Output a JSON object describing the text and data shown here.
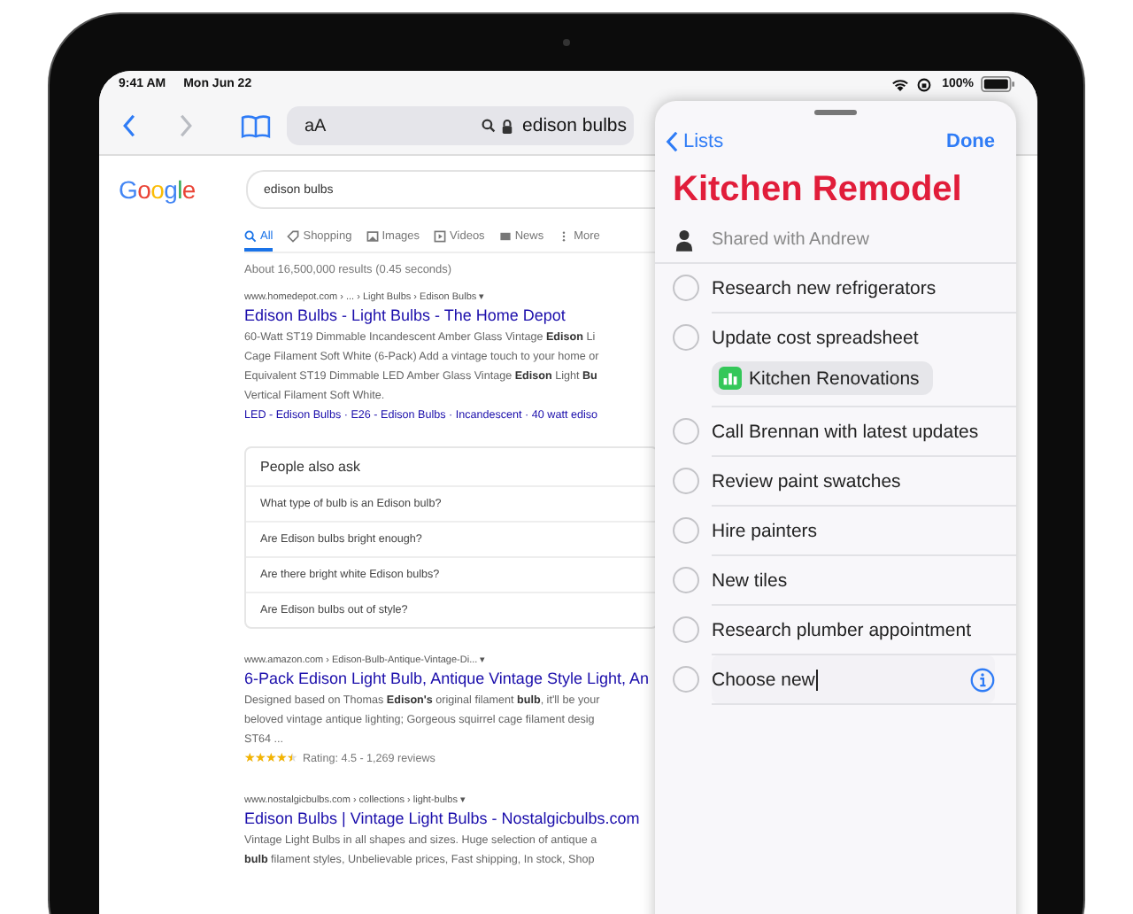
{
  "status_bar": {
    "time": "9:41 AM",
    "date": "Mon Jun 22",
    "battery": "100%"
  },
  "toolbar": {
    "text_size": "aA",
    "address": "edison bulbs"
  },
  "google": {
    "logo": "Google",
    "query": "edison bulbs",
    "tabs": [
      {
        "label": "All",
        "selected": true,
        "kind": "search"
      },
      {
        "label": "Shopping",
        "selected": false,
        "kind": "tag"
      },
      {
        "label": "Images",
        "selected": false,
        "kind": "image"
      },
      {
        "label": "Videos",
        "selected": false,
        "kind": "video"
      },
      {
        "label": "News",
        "selected": false,
        "kind": "news"
      },
      {
        "label": "More",
        "selected": false,
        "kind": "more"
      }
    ],
    "stats": "About 16,500,000 results (0.45 seconds)",
    "results": [
      {
        "url": "www.homedepot.com › ... › Light Bulbs › Edison Bulbs ▾",
        "title": "Edison Bulbs - Light Bulbs - The Home Depot",
        "lines": [
          "60-Watt ST19 Dimmable Incandescent Amber Glass Vintage **Edison** Li",
          "Cage Filament Soft White (6-Pack) Add a vintage touch to your home or",
          "Equivalent ST19 Dimmable LED Amber Glass Vintage **Edison** Light **Bu**",
          "Vertical Filament Soft White."
        ],
        "sitelinks": "LED - Edison Bulbs · E26 - Edison Bulbs · Incandescent · 40 watt ediso",
        "people_also_ask": {
          "heading": "People also ask",
          "questions": [
            "What type of bulb is an Edison bulb?",
            "Are Edison bulbs bright enough?",
            "Are there bright white Edison bulbs?",
            "Are Edison bulbs out of style?"
          ]
        }
      },
      {
        "url": "www.amazon.com › Edison-Bulb-Antique-Vintage-Di... ▾",
        "title": "6-Pack Edison Light Bulb, Antique Vintage Style Light, An",
        "lines": [
          "Designed based on Thomas **Edison's** original filament **bulb**, it'll be your",
          "beloved vintage antique lighting; Gorgeous squirrel cage filament desig",
          "ST64 ..."
        ],
        "stars": 4.5,
        "rating": "Rating: 4.5 - 1,269 reviews"
      },
      {
        "url": "www.nostalgicbulbs.com › collections › light-bulbs ▾",
        "title": "Edison Bulbs | Vintage Light Bulbs - Nostalgicbulbs.com",
        "lines": [
          "Vintage Light Bulbs in all shapes and sizes. Huge selection of antique a",
          "**bulb** filament styles, Unbelievable prices, Fast shipping, In stock, Shop"
        ]
      }
    ]
  },
  "reminders": {
    "back": "Lists",
    "done": "Done",
    "title": "Kitchen Remodel",
    "shared": "Shared with Andrew",
    "items": [
      {
        "text": "Research new refrigerators",
        "checked": false,
        "editing": false
      },
      {
        "text": "Update cost spreadsheet",
        "checked": false,
        "editing": false,
        "attachment": "Kitchen Renovations"
      },
      {
        "text": "Call Brennan with latest updates",
        "checked": false,
        "editing": false
      },
      {
        "text": "Review paint swatches",
        "checked": false,
        "editing": false
      },
      {
        "text": "Hire painters",
        "checked": false,
        "editing": false
      },
      {
        "text": "New tiles",
        "checked": false,
        "editing": false
      },
      {
        "text": "Research plumber appointment",
        "checked": false,
        "editing": false
      },
      {
        "text": "Choose new",
        "checked": false,
        "editing": true
      }
    ]
  }
}
